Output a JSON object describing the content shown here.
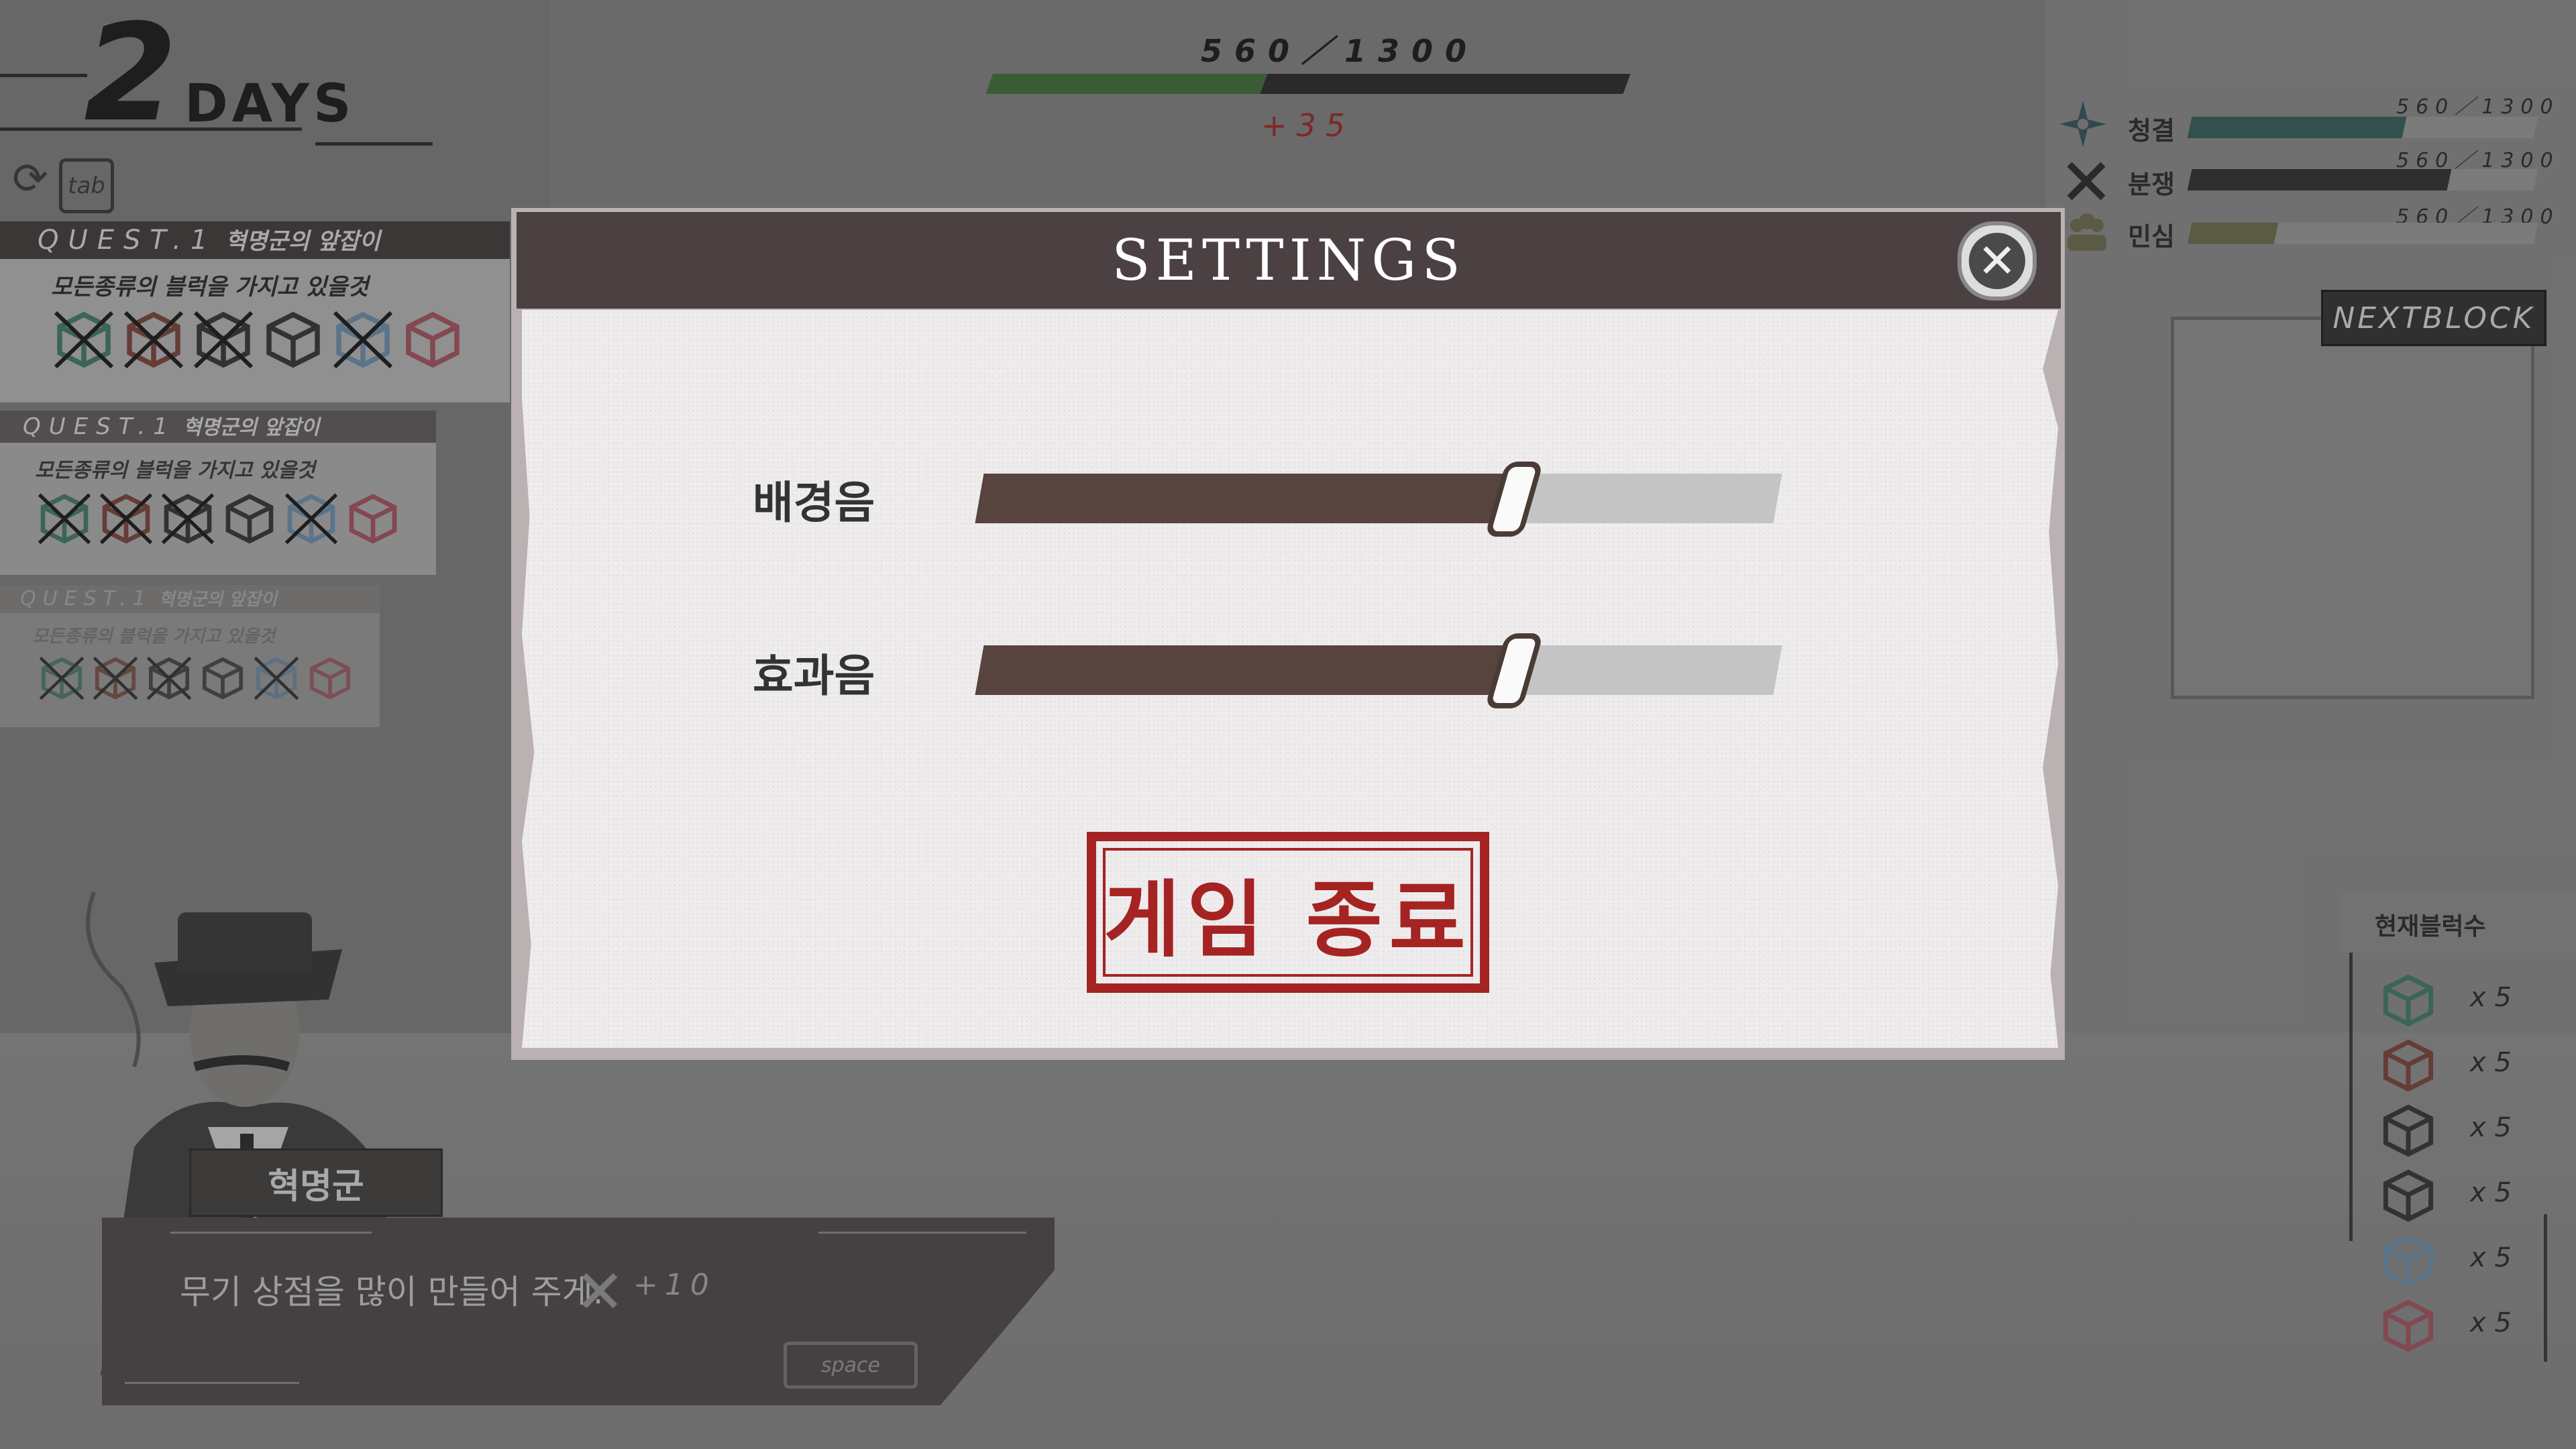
{
  "day": {
    "number": "2",
    "label": "DAYS"
  },
  "tab_key": "tab",
  "progress": {
    "text": "560／1300",
    "current": 560,
    "max": 1300,
    "gain": "+35",
    "color": "#3a6b33"
  },
  "stats": [
    {
      "label": "청결",
      "value": "560／1300",
      "fraction": 0.62,
      "color": "#2f5b57",
      "icon": "compass-star-icon"
    },
    {
      "label": "분쟁",
      "value": "560／1300",
      "fraction": 0.75,
      "color": "#2a2a2a",
      "icon": "crossed-swords-icon"
    },
    {
      "label": "민심",
      "value": "560／1300",
      "fraction": 0.25,
      "color": "#6b6a4a",
      "icon": "crowd-icon"
    }
  ],
  "quests": [
    {
      "head": "QUEST.1",
      "title": "혁명군의 앞잡이",
      "desc": "모든종류의 블럭을 가지고 있을것"
    },
    {
      "head": "QUEST.1",
      "title": "혁명군의 앞잡이",
      "desc": "모든종류의 블럭을 가지고 있을것"
    },
    {
      "head": "QUEST.1",
      "title": "혁명군의 앞잡이",
      "desc": "모든종류의 블럭을 가지고 있을것"
    }
  ],
  "next_block": {
    "label": "NEXTBLOCK"
  },
  "current_blocks": {
    "title": "현재블럭수",
    "items": [
      {
        "color": "#3b7a62",
        "count": "x 5"
      },
      {
        "color": "#7a3e34",
        "count": "x 5"
      },
      {
        "color": "#2e2e2e",
        "count": "x 5"
      },
      {
        "color": "#2e2e2e",
        "count": "x 5"
      },
      {
        "color": "#6b8fae",
        "count": "x 5"
      },
      {
        "color": "#a54e5c",
        "count": "x 5"
      }
    ]
  },
  "dialog": {
    "speaker": "혁명군",
    "text": "무기 상점을 많이 만들어 주게.",
    "reward": "+10",
    "space_key": "space"
  },
  "settings": {
    "title": "SETTINGS",
    "bgm": {
      "label": "배경음",
      "value": 0.67
    },
    "sfx": {
      "label": "효과음",
      "value": 0.67
    },
    "quit_label": "게임 종료"
  },
  "colors": {
    "header": "#4b4142",
    "stamp": "#a52323",
    "slider_fill": "#57443f"
  }
}
